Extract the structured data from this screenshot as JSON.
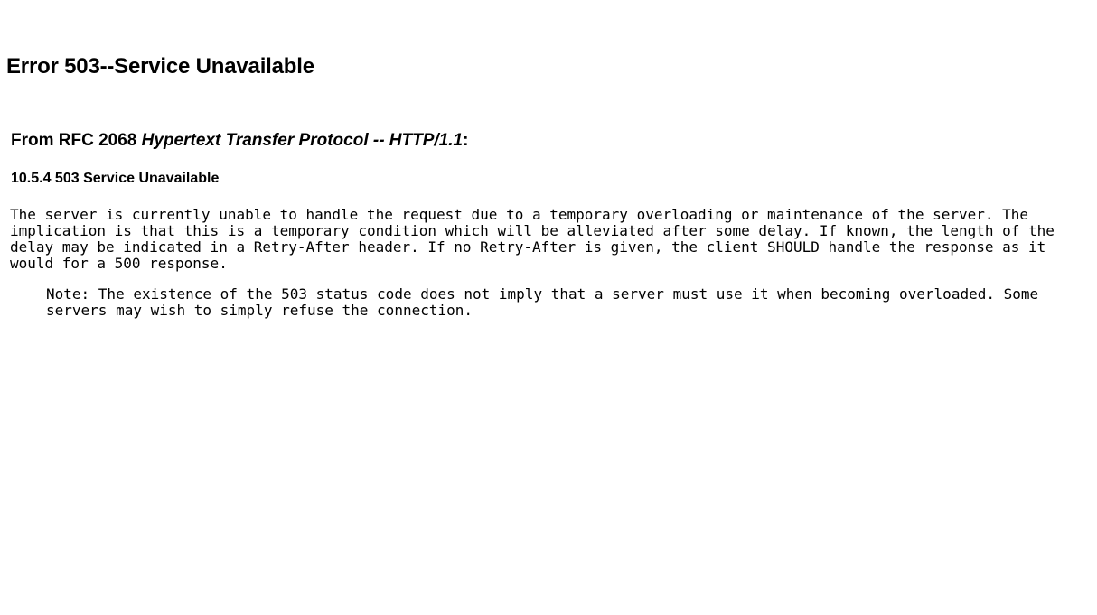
{
  "document": {
    "title": "Error 503--Service Unavailable",
    "background_color": "#ffffff",
    "text_color": "#000000"
  },
  "error_page": {
    "heading": "Error 503--Service Unavailable",
    "attribution": {
      "prefix": "From RFC 2068 ",
      "rfc_title": "Hypertext Transfer Protocol -- HTTP/1.1",
      "suffix": ":"
    },
    "section_heading": "10.5.4 503 Service Unavailable",
    "body_paragraph": "The server is currently unable to handle the request due to a temporary overloading or maintenance of the server. The implication is that this is a temporary condition which will be alleviated after some delay. If known, the length of the delay may be indicated in a Retry-After header. If no Retry-After is given, the client SHOULD handle the response as it would for a 500 response.",
    "note_paragraph": "Note: The existence of the 503 status code does not imply that a server must use it when becoming overloaded. Some servers may wish to simply refuse the connection."
  }
}
